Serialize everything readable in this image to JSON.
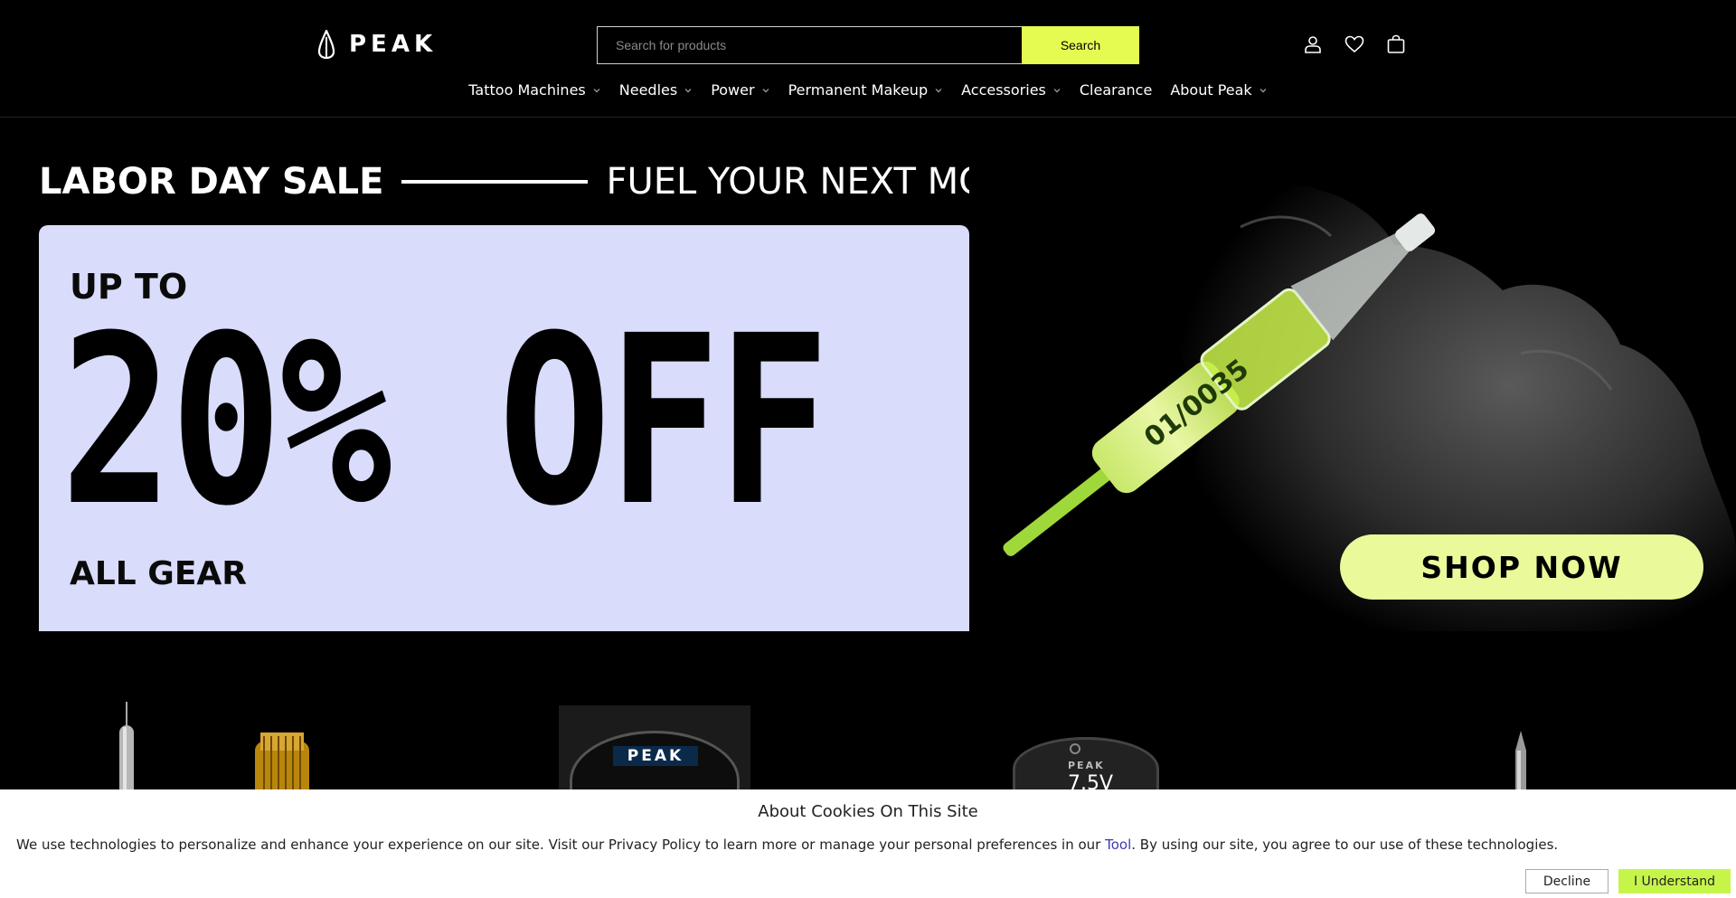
{
  "header": {
    "logo_text": "PEAK",
    "search": {
      "placeholder": "Search for products",
      "button_label": "Search"
    },
    "icons": [
      "account-icon",
      "heart-icon",
      "cart-icon"
    ]
  },
  "nav": {
    "items": [
      {
        "label": "Tattoo Machines",
        "has_dropdown": true
      },
      {
        "label": "Needles",
        "has_dropdown": true
      },
      {
        "label": "Power",
        "has_dropdown": true
      },
      {
        "label": "Permanent Makeup",
        "has_dropdown": true
      },
      {
        "label": "Accessories",
        "has_dropdown": true
      },
      {
        "label": "Clearance",
        "has_dropdown": false
      },
      {
        "label": "About Peak",
        "has_dropdown": true
      }
    ]
  },
  "hero": {
    "headline_left": "LABOR DAY SALE",
    "headline_right": "FUEL YOUR NEXT MOVE",
    "up_to": "UP TO",
    "discount": "20% OFF",
    "scope": "ALL GEAR",
    "cta": "SHOP NOW",
    "cartridge_label": "01/0035",
    "colors": {
      "panel": "#d9dcfb",
      "cta": "#eaf99a",
      "accent": "#e6fb52"
    }
  },
  "products": {
    "device_logo": "PEAK",
    "power_readout": "7.5V"
  },
  "cookie": {
    "title": "About Cookies On This Site",
    "text_before": "We use technologies to personalize and enhance your experience on our site. Visit our Privacy Policy to learn more or manage your personal preferences in our ",
    "link": "Tool",
    "text_after": ". By using our site, you agree to our use of these technologies.",
    "decline_label": "Decline",
    "accept_label": "I Understand"
  }
}
